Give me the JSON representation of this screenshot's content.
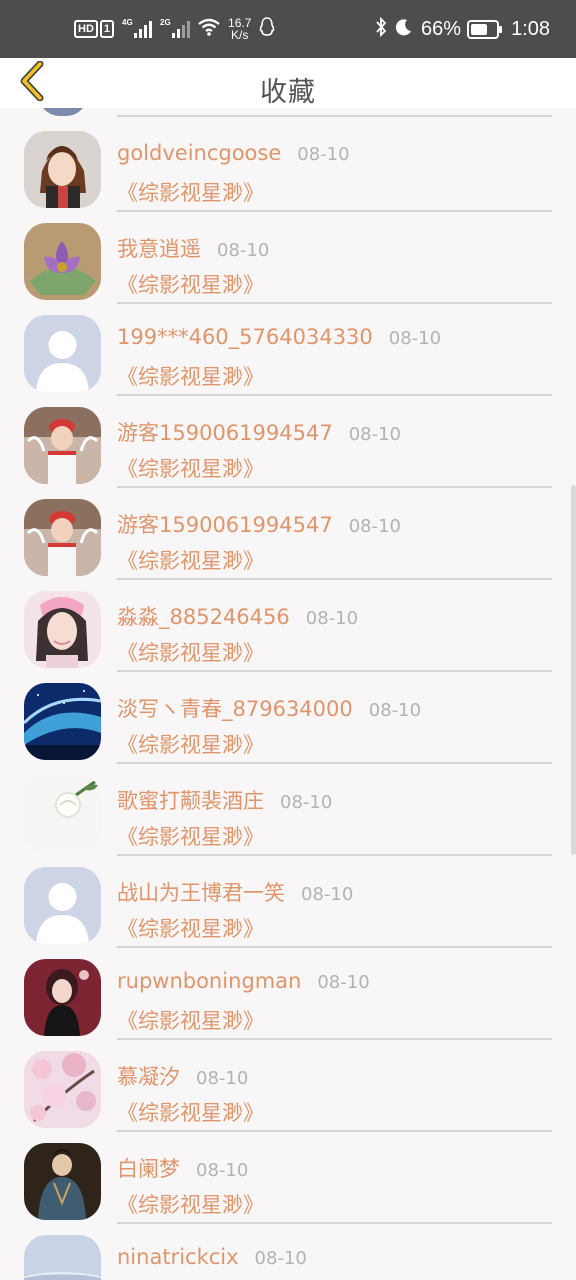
{
  "status_bar": {
    "hd_label": "HD",
    "sim1_label": "1",
    "sim1_net": "4G",
    "sim2_net": "2G",
    "speed_value": "16.7",
    "speed_unit": "K/s",
    "battery_text": "66%",
    "battery_level": 0.66,
    "time": "1:08"
  },
  "header": {
    "title": "收藏",
    "back_icon": "chevron-left-icon"
  },
  "colors": {
    "accent": "#e0956a",
    "date": "#b3b3b3",
    "divider": "#d6d6d6",
    "background": "#f8f6f7"
  },
  "items": [
    {
      "name": "goldveincgoose",
      "date": "08-10",
      "book": "《综影视星渺》",
      "avatar": "anime-boy-avatar"
    },
    {
      "name": "我意逍遥",
      "date": "08-10",
      "book": "《综影视星渺》",
      "avatar": "purple-flower-avatar"
    },
    {
      "name": "199***460_5764034330",
      "date": "08-10",
      "book": "《综影视星渺》",
      "avatar": "default-user-avatar"
    },
    {
      "name": "游客1590061994547",
      "date": "08-10",
      "book": "《综影视星渺》",
      "avatar": "child-photo-avatar"
    },
    {
      "name": "游客1590061994547",
      "date": "08-10",
      "book": "《综影视星渺》",
      "avatar": "child-photo-avatar"
    },
    {
      "name": "淼淼_885246456",
      "date": "08-10",
      "book": "《综影视星渺》",
      "avatar": "girl-photo-avatar"
    },
    {
      "name": "淡写ヽ青春_879634000",
      "date": "08-10",
      "book": "《综影视星渺》",
      "avatar": "aurora-avatar"
    },
    {
      "name": "歌蜜打颟裴酒庄",
      "date": "08-10",
      "book": "《综影视星渺》",
      "avatar": "white-rose-avatar"
    },
    {
      "name": "战山为王博君一笑",
      "date": "08-10",
      "book": "《综影视星渺》",
      "avatar": "default-user-avatar"
    },
    {
      "name": "rupwnboningman",
      "date": "08-10",
      "book": "《综影视星渺》",
      "avatar": "anime-girl-avatar"
    },
    {
      "name": "慕凝汐",
      "date": "08-10",
      "book": "《综影视星渺》",
      "avatar": "cherry-blossom-avatar"
    },
    {
      "name": "白阑梦",
      "date": "08-10",
      "book": "《综影视星渺》",
      "avatar": "costume-drama-avatar"
    },
    {
      "name": "ninatrickcix",
      "date": "08-10",
      "book": "《综影视星渺》",
      "avatar": "sky-photo-avatar"
    }
  ]
}
